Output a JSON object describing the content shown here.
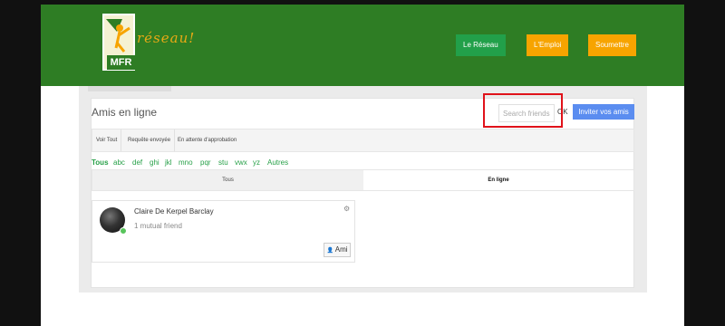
{
  "header": {
    "logo": {
      "mfr": "MFR",
      "reseau": "réseau!"
    },
    "nav": [
      {
        "label": "Le Réseau"
      },
      {
        "label": "L'Emploi"
      },
      {
        "label": "Soumettre"
      }
    ]
  },
  "friends": {
    "title": "Amis en ligne",
    "search_placeholder": "Search friends",
    "ok_label": "OK",
    "invite_label": "Inviter vos amis",
    "filters": [
      {
        "label": "Voir Tout"
      },
      {
        "label": "Requête envoyée"
      },
      {
        "label": "En attente d'approbation"
      }
    ],
    "alphabet": [
      "Tous",
      "abc",
      "def",
      "ghi",
      "jkl",
      "mno",
      "pqr",
      "stu",
      "vwx",
      "yz",
      "Autres"
    ],
    "view_tabs": [
      {
        "label": "Tous"
      },
      {
        "label": "En ligne"
      }
    ],
    "cards": [
      {
        "name": "Claire De Kerpel Barclay",
        "mutual": "1 mutual friend",
        "action": "Ami",
        "status": "online"
      }
    ]
  },
  "colors": {
    "header_green": "#2e7d24",
    "nav_orange": "#f7a400",
    "nav_green": "#22a04a",
    "link_green": "#27a048",
    "invite_blue": "#5b8df0",
    "highlight_red": "#e0121a"
  },
  "icons": [
    "gear-icon",
    "user-icon",
    "online-status-icon"
  ]
}
